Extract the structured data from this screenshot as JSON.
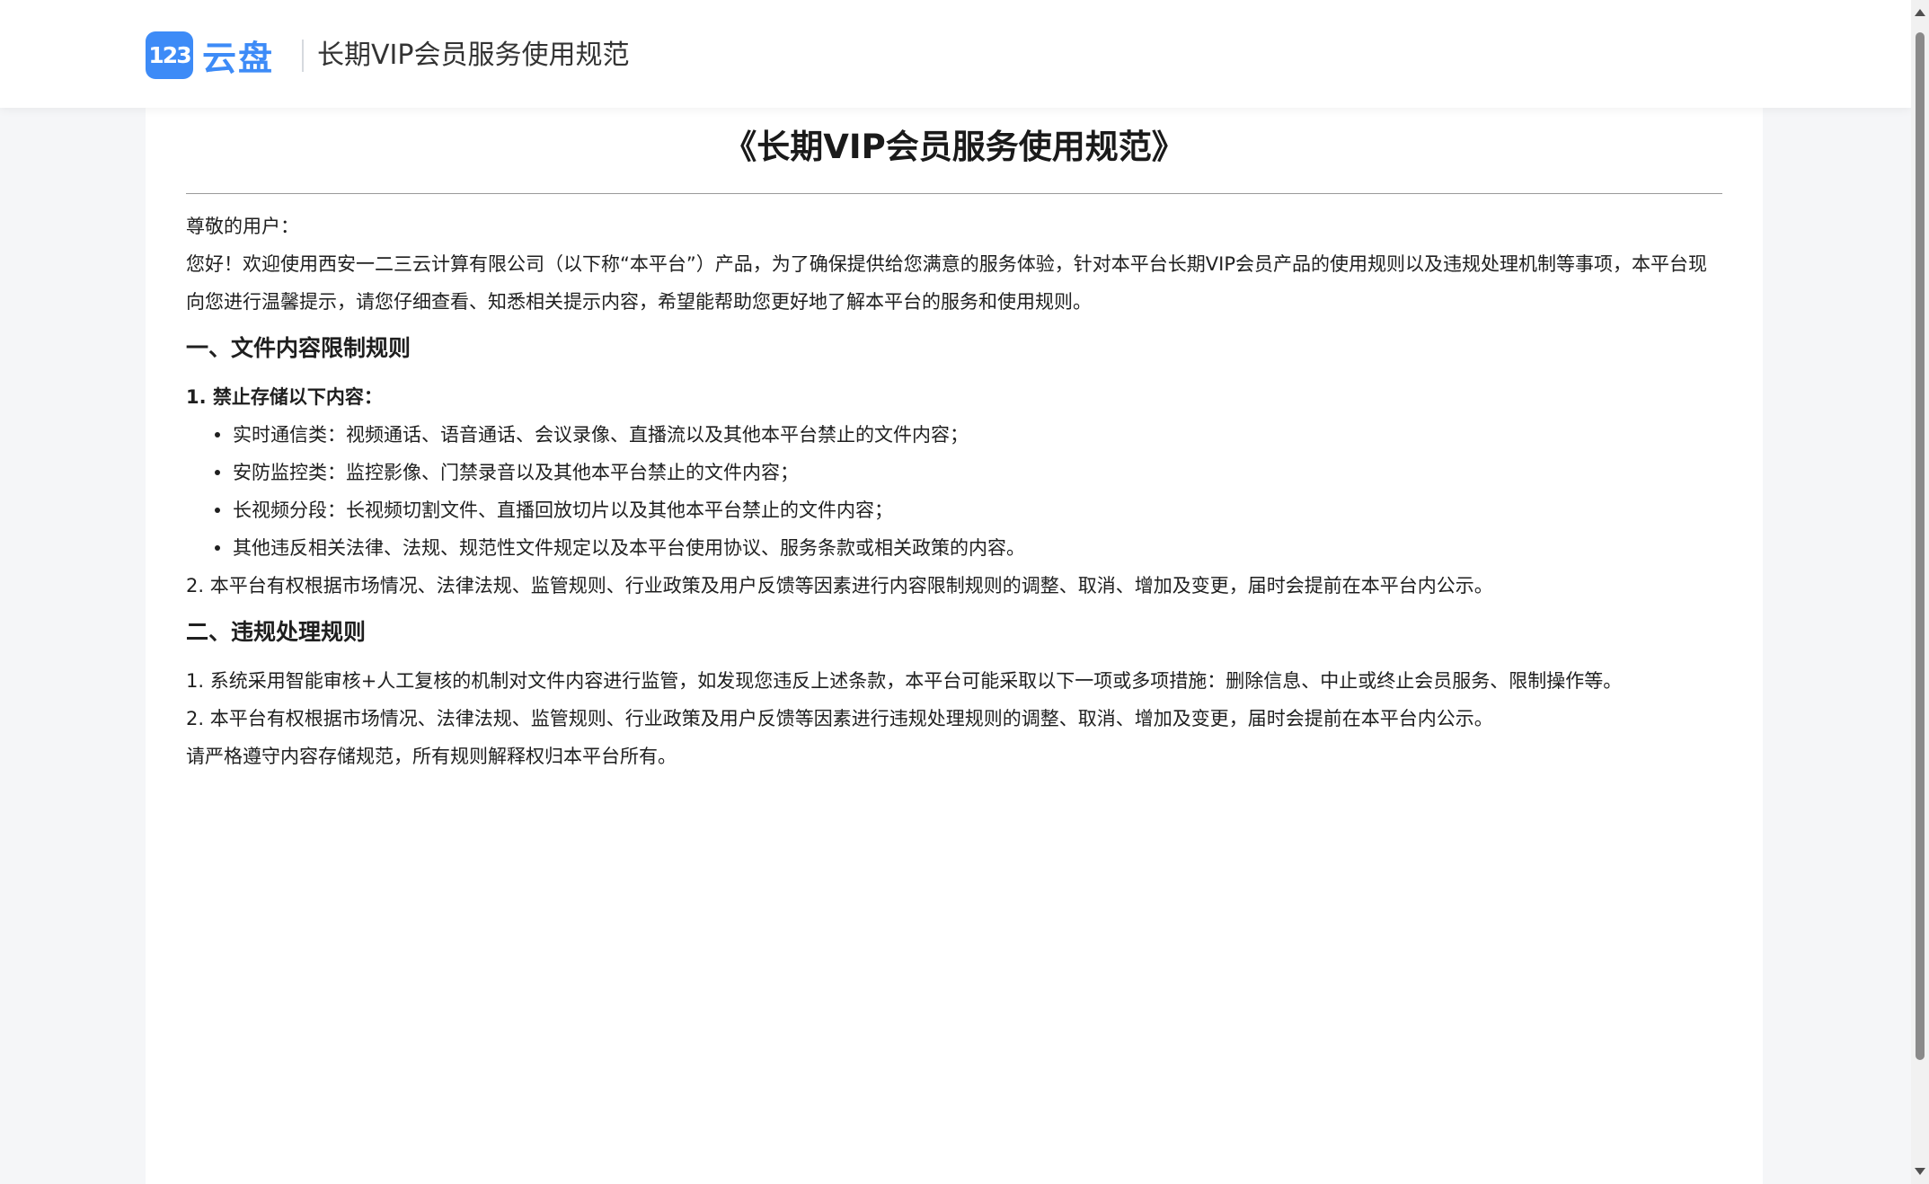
{
  "header": {
    "logo_badge": "123",
    "logo_text": "云盘",
    "title": "长期VIP会员服务使用规范"
  },
  "document": {
    "title": "《长期VIP会员服务使用规范》",
    "greeting": "尊敬的用户：",
    "intro": "您好！欢迎使用西安一二三云计算有限公司（以下称“本平台”）产品，为了确保提供给您满意的服务体验，针对本平台长期VIP会员产品的使用规则以及违规处理机制等事项，本平台现向您进行温馨提示，请您仔细查看、知悉相关提示内容，希望能帮助您更好地了解本平台的服务和使用规则。",
    "section1": {
      "heading": "一、文件内容限制规则",
      "sub_heading": "1. 禁止存储以下内容：",
      "bullets": [
        "实时通信类：视频通话、语音通话、会议录像、直播流以及其他本平台禁止的文件内容；",
        "安防监控类：监控影像、门禁录音以及其他本平台禁止的文件内容；",
        "长视频分段：长视频切割文件、直播回放切片以及其他本平台禁止的文件内容；",
        "其他违反相关法律、法规、规范性文件规定以及本平台使用协议、服务条款或相关政策的内容。"
      ],
      "item2": "2. 本平台有权根据市场情况、法律法规、监管规则、行业政策及用户反馈等因素进行内容限制规则的调整、取消、增加及变更，届时会提前在本平台内公示。"
    },
    "section2": {
      "heading": "二、违规处理规则",
      "item1": "1. 系统采用智能审核+人工复核的机制对文件内容进行监管，如发现您违反上述条款，本平台可能采取以下一项或多项措施：删除信息、中止或终止会员服务、限制操作等。",
      "item2": "2. 本平台有权根据市场情况、法律法规、监管规则、行业政策及用户反馈等因素进行违规处理规则的调整、取消、增加及变更，届时会提前在本平台内公示。"
    },
    "closing": "请严格遵守内容存储规范，所有规则解释权归本平台所有。"
  },
  "colors": {
    "brand": "#3d8bf7",
    "page_bg": "#f5f6f8",
    "card_bg": "#ffffff",
    "text": "#1f1f1f"
  }
}
